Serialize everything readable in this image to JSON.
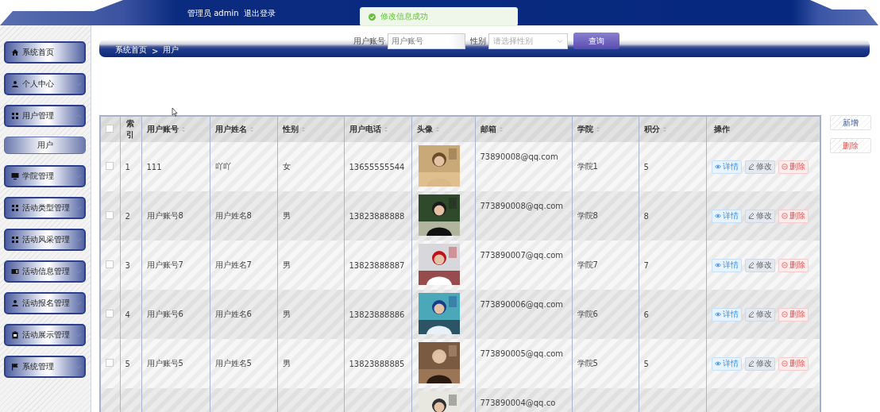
{
  "header": {
    "user_label": "管理员 admin",
    "logout": "退出登录"
  },
  "toast": {
    "message": "修改信息成功"
  },
  "sidebar": {
    "items": [
      {
        "label": "系统首页",
        "kind": "link"
      },
      {
        "label": "个人中心",
        "kind": "menu",
        "expanded": false
      },
      {
        "label": "用户管理",
        "kind": "menu",
        "expanded": true,
        "children": [
          {
            "label": "用户"
          }
        ]
      },
      {
        "label": "学院管理",
        "kind": "menu",
        "expanded": false
      },
      {
        "label": "活动类型管理",
        "kind": "menu",
        "expanded": false
      },
      {
        "label": "活动风采管理",
        "kind": "menu",
        "expanded": false
      },
      {
        "label": "活动信息管理",
        "kind": "menu",
        "expanded": false
      },
      {
        "label": "活动报名管理",
        "kind": "menu",
        "expanded": false
      },
      {
        "label": "活动展示管理",
        "kind": "menu",
        "expanded": false
      },
      {
        "label": "系统管理",
        "kind": "menu",
        "expanded": false
      }
    ]
  },
  "search": {
    "fields": [
      {
        "label": "用户账号",
        "placeholder": "用户账号",
        "kind": "text"
      },
      {
        "label": "性别",
        "placeholder": "请选择性别",
        "kind": "select"
      }
    ],
    "button": "查询"
  },
  "breadcrumb": {
    "items": [
      "系统首页",
      "用户"
    ],
    "separator": ">"
  },
  "table": {
    "select_all_checked": false,
    "columns": [
      {
        "label": "索引",
        "sortable": false
      },
      {
        "label": "用户账号",
        "sortable": true
      },
      {
        "label": "用户姓名",
        "sortable": true
      },
      {
        "label": "性别",
        "sortable": true
      },
      {
        "label": "用户电话",
        "sortable": true
      },
      {
        "label": "头像",
        "sortable": true
      },
      {
        "label": "邮箱",
        "sortable": true
      },
      {
        "label": "学院",
        "sortable": true
      },
      {
        "label": "积分",
        "sortable": true
      },
      {
        "label": "操作",
        "sortable": false
      }
    ],
    "rows": [
      {
        "checked": false,
        "index": "1",
        "account": "111",
        "name": "吖吖",
        "gender": "女",
        "phone": "13655555544",
        "email": "73890008@qq.com",
        "college": "学院1",
        "score": "5",
        "actions": [
          {
            "kind": "view",
            "label": "详情"
          },
          {
            "kind": "edit",
            "label": "修改"
          },
          {
            "kind": "delete",
            "label": "删除"
          }
        ]
      },
      {
        "checked": false,
        "index": "2",
        "account": "用户账号8",
        "name": "用户姓名8",
        "gender": "男",
        "phone": "13823888888",
        "email": "773890008@qq.com",
        "college": "学院8",
        "score": "8",
        "actions": [
          {
            "kind": "view",
            "label": "详情"
          },
          {
            "kind": "edit",
            "label": "修改"
          },
          {
            "kind": "delete",
            "label": "删除"
          }
        ]
      },
      {
        "checked": false,
        "index": "3",
        "account": "用户账号7",
        "name": "用户姓名7",
        "gender": "男",
        "phone": "13823888887",
        "email": "773890007@qq.com",
        "college": "学院7",
        "score": "7",
        "actions": [
          {
            "kind": "view",
            "label": "详情"
          },
          {
            "kind": "edit",
            "label": "修改"
          },
          {
            "kind": "delete",
            "label": "删除"
          }
        ]
      },
      {
        "checked": false,
        "index": "4",
        "account": "用户账号6",
        "name": "用户姓名6",
        "gender": "男",
        "phone": "13823888886",
        "email": "773890006@qq.com",
        "college": "学院6",
        "score": "6",
        "actions": [
          {
            "kind": "view",
            "label": "详情"
          },
          {
            "kind": "edit",
            "label": "修改"
          },
          {
            "kind": "delete",
            "label": "删除"
          }
        ]
      },
      {
        "checked": false,
        "index": "5",
        "account": "用户账号5",
        "name": "用户姓名5",
        "gender": "男",
        "phone": "13823888885",
        "email": "773890005@qq.com",
        "college": "学院5",
        "score": "5",
        "actions": [
          {
            "kind": "view",
            "label": "详情"
          },
          {
            "kind": "edit",
            "label": "修改"
          },
          {
            "kind": "delete",
            "label": "删除"
          }
        ]
      },
      {
        "email": "773890004@qq.co"
      }
    ]
  },
  "side_buttons": [
    {
      "kind": "add",
      "label": "新增"
    },
    {
      "kind": "delete",
      "label": "删除"
    }
  ]
}
